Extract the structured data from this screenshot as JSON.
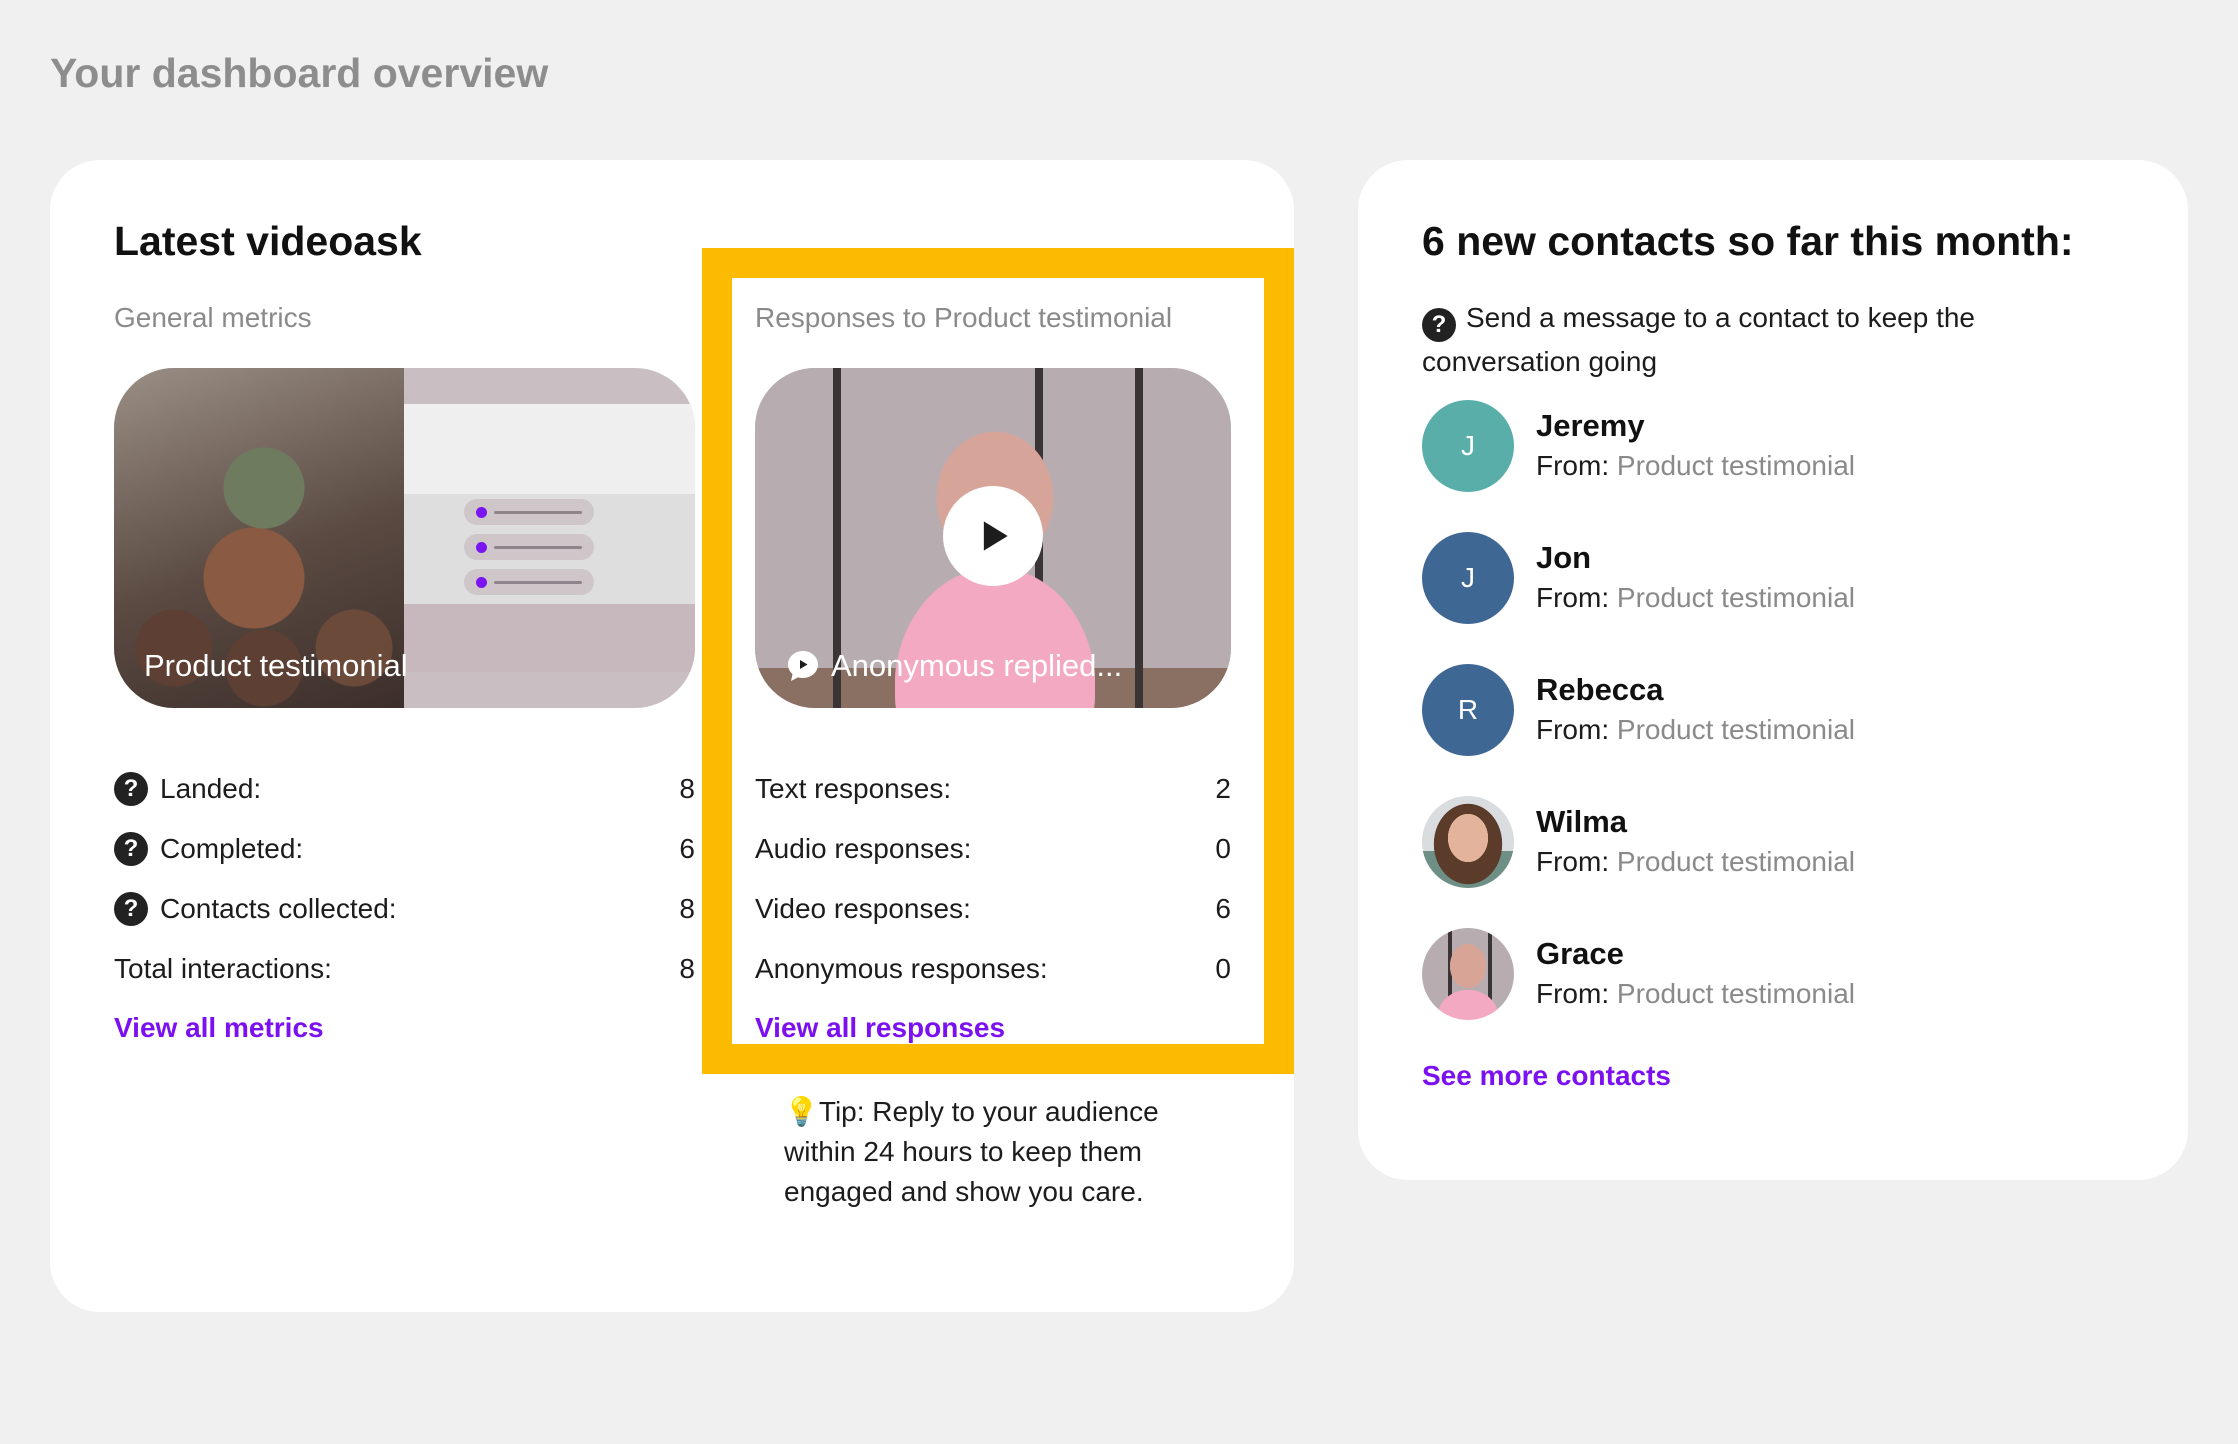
{
  "page": {
    "heading": "Your dashboard overview"
  },
  "colors": {
    "accent": "#7b10f0",
    "highlight": "#fdbb00",
    "avatar_teal": "#59aeaa",
    "avatar_blue": "#3f6794"
  },
  "videoask": {
    "title": "Latest videoask",
    "general": {
      "label": "General metrics",
      "thumbnail_caption": "Product testimonial",
      "metrics": [
        {
          "label": "Landed:",
          "value": "8",
          "help": true
        },
        {
          "label": "Completed:",
          "value": "6",
          "help": true
        },
        {
          "label": "Contacts collected:",
          "value": "8",
          "help": true
        },
        {
          "label": "Total interactions:",
          "value": "8",
          "help": false
        }
      ],
      "link": "View all metrics"
    },
    "responses": {
      "label": "Responses to Product testimonial",
      "thumbnail_caption": "Anonymous replied...",
      "metrics": [
        {
          "label": "Text responses:",
          "value": "2"
        },
        {
          "label": "Audio responses:",
          "value": "0"
        },
        {
          "label": "Video responses:",
          "value": "6"
        },
        {
          "label": "Anonymous responses:",
          "value": "0"
        }
      ],
      "link": "View all responses"
    },
    "tip": {
      "icon": "lightbulb-icon",
      "text": "Tip: Reply to your audience within 24 hours to keep them engaged and show you care."
    }
  },
  "contacts": {
    "title": "6 new contacts so far this month:",
    "note": "Send a message to a contact to keep the conversation going",
    "from_label": "From:",
    "items": [
      {
        "name": "Jeremy",
        "initial": "J",
        "source": "Product testimonial"
      },
      {
        "name": "Jon",
        "initial": "J",
        "source": "Product testimonial"
      },
      {
        "name": "Rebecca",
        "initial": "R",
        "source": "Product testimonial"
      },
      {
        "name": "Wilma",
        "initial": "",
        "source": "Product testimonial"
      },
      {
        "name": "Grace",
        "initial": "",
        "source": "Product testimonial"
      }
    ],
    "link": "See more contacts"
  }
}
